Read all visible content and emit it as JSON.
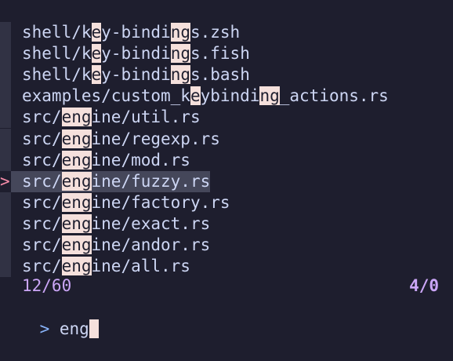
{
  "items": [
    {
      "parts": [
        "shell/k",
        "e",
        "y-bindi",
        "ng",
        "s.zsh"
      ]
    },
    {
      "parts": [
        "shell/k",
        "e",
        "y-bindi",
        "ng",
        "s.fish"
      ]
    },
    {
      "parts": [
        "shell/k",
        "e",
        "y-bindi",
        "ng",
        "s.bash"
      ]
    },
    {
      "parts": [
        "examples/custom_k",
        "e",
        "ybindi",
        "ng",
        "_actions.rs"
      ]
    },
    {
      "parts": [
        "src/",
        "eng",
        "ine/util.rs",
        "",
        ""
      ]
    },
    {
      "parts": [
        "src/",
        "eng",
        "ine/regexp.rs",
        "",
        ""
      ]
    },
    {
      "parts": [
        "src/",
        "eng",
        "ine/mod.rs",
        "",
        ""
      ]
    },
    {
      "parts": [
        "src/",
        "eng",
        "ine/fuzzy.rs",
        "",
        ""
      ],
      "selected": true
    },
    {
      "parts": [
        "src/",
        "eng",
        "ine/factory.rs",
        "",
        ""
      ]
    },
    {
      "parts": [
        "src/",
        "eng",
        "ine/exact.rs",
        "",
        ""
      ]
    },
    {
      "parts": [
        "src/",
        "eng",
        "ine/andor.rs",
        "",
        ""
      ]
    },
    {
      "parts": [
        "src/",
        "eng",
        "ine/all.rs",
        "",
        ""
      ]
    }
  ],
  "selection_marker": ">",
  "status": {
    "matched": "12/60",
    "selected_count": "4/0"
  },
  "prompt": {
    "symbol": "> ",
    "query": "eng"
  },
  "colors": {
    "background": "#1e1e2e",
    "match_highlight": "#f5e0dc",
    "selected_row": "#45475a",
    "info": "#cba6f7"
  }
}
